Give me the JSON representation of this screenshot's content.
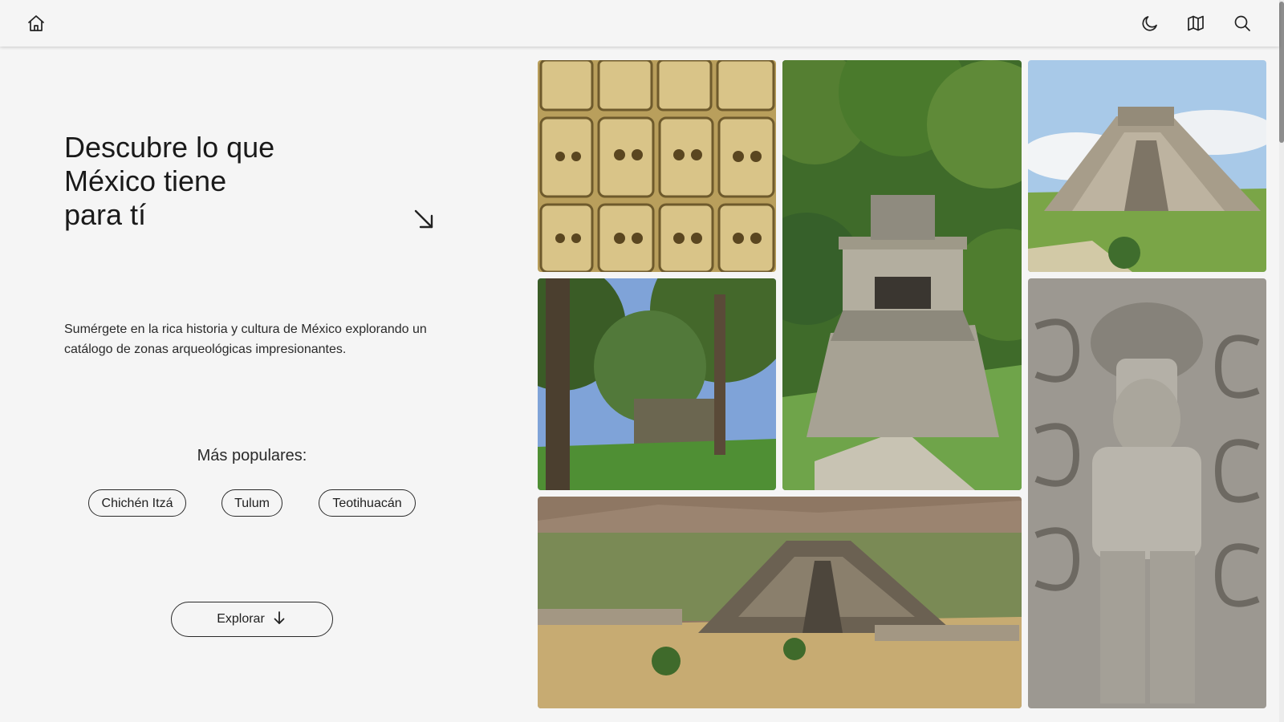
{
  "nav": {
    "home_icon": "home-icon",
    "theme_icon": "moon-icon",
    "map_icon": "map-icon",
    "search_icon": "search-icon"
  },
  "hero": {
    "title_line1": "Descubre lo que",
    "title_line2": "México tiene",
    "title_line3": "para tí",
    "arrow_icon": "arrow-down-right-icon",
    "description": "Sumérgete en la rica historia y cultura de México explorando un catálogo de zonas arqueológicas impresionantes."
  },
  "popular": {
    "title": "Más populares:",
    "chips": [
      "Chichén Itzá",
      "Tulum",
      "Teotihuacán"
    ]
  },
  "explore": {
    "label": "Explorar",
    "icon": "arrow-down-icon"
  },
  "gallery": {
    "photos": [
      "skull-carvings-photo",
      "temple-in-jungle-photo",
      "pyramid-photo",
      "forest-ruins-photo",
      "stone-warrior-statue-photo",
      "pyramid-valley-photo"
    ]
  },
  "colors": {
    "background": "#f5f5f5",
    "text": "#1c1c1c",
    "border": "#2a2a2a"
  }
}
